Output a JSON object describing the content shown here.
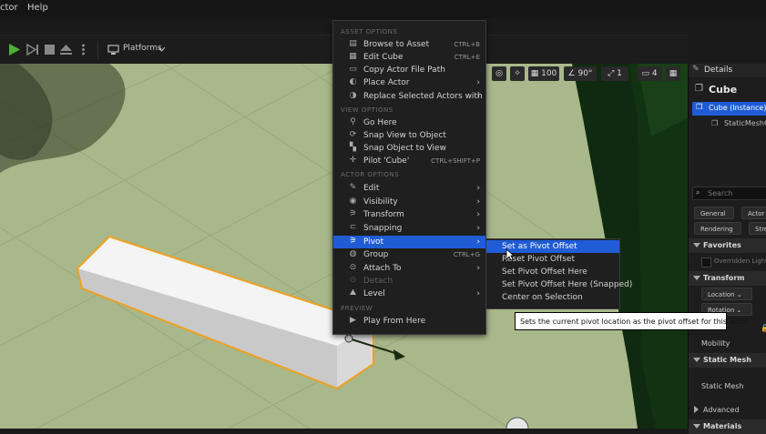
{
  "menubar": {
    "items": [
      "ctor",
      "Help"
    ]
  },
  "toolbar": {
    "platforms_label": "Platforms"
  },
  "viewport": {
    "tools": {
      "grid": "100",
      "angle": "90°",
      "scale": "1",
      "camera": "4"
    }
  },
  "context_menu": {
    "sections": {
      "asset": "ASSET OPTIONS",
      "view": "VIEW OPTIONS",
      "actor": "ACTOR OPTIONS",
      "preview": "PREVIEW"
    },
    "items": [
      {
        "label": "Browse to Asset",
        "shortcut": "CTRL+B",
        "icon": "folder-icon"
      },
      {
        "label": "Edit Cube",
        "shortcut": "CTRL+E",
        "icon": "edit-asset-icon"
      },
      {
        "label": "Copy Actor File Path",
        "shortcut": "",
        "icon": "copy-icon"
      },
      {
        "label": "Place Actor",
        "submenu": true,
        "icon": "place-actor-icon"
      },
      {
        "label": "Replace Selected Actors with",
        "submenu": true,
        "icon": "replace-icon"
      },
      {
        "label": "Go Here",
        "icon": "go-here-icon"
      },
      {
        "label": "Snap View to Object",
        "icon": "snap-view-icon"
      },
      {
        "label": "Snap Object to View",
        "icon": "snap-object-icon"
      },
      {
        "label": "Pilot 'Cube'",
        "shortcut": "CTRL+SHIFT+P",
        "icon": "pilot-icon"
      },
      {
        "label": "Edit",
        "submenu": true,
        "icon": "pencil-icon"
      },
      {
        "label": "Visibility",
        "submenu": true,
        "icon": "eye-icon"
      },
      {
        "label": "Transform",
        "submenu": true,
        "icon": "transform-icon"
      },
      {
        "label": "Snapping",
        "submenu": true,
        "icon": "magnet-icon"
      },
      {
        "label": "Pivot",
        "submenu": true,
        "icon": "pivot-icon"
      },
      {
        "label": "Group",
        "shortcut": "CTRL+G",
        "icon": "group-icon"
      },
      {
        "label": "Attach To",
        "submenu": true,
        "icon": "attach-icon"
      },
      {
        "label": "Detach",
        "disabled": true,
        "icon": "detach-icon"
      },
      {
        "label": "Level",
        "submenu": true,
        "icon": "level-icon"
      },
      {
        "label": "Play From Here",
        "icon": "play-icon"
      }
    ]
  },
  "pivot_submenu": {
    "items": [
      "Set as Pivot Offset",
      "Reset Pivot Offset",
      "Set Pivot Offset Here",
      "Set Pivot Offset Here (Snapped)",
      "Center on Selection"
    ]
  },
  "tooltip": "Sets the current pivot location as the pivot offset for this actor",
  "details": {
    "title": "Details",
    "actor_name": "Cube",
    "tree": [
      "Cube (Instance)",
      "StaticMeshC"
    ],
    "search_placeholder": "Search",
    "filters": [
      "General",
      "Actor",
      "Rendering",
      "Stre"
    ],
    "sections": {
      "favorites": "Favorites",
      "favorites_item": "Overridden Light",
      "transform": "Transform",
      "location": "Location",
      "rotation": "Rotation",
      "mobility": "Mobility",
      "static_mesh": "Static Mesh",
      "static_mesh_prop": "Static Mesh",
      "advanced": "Advanced",
      "materials": "Materials"
    }
  },
  "colors": {
    "selection": "#1f5cd6",
    "grass": "#a9b88a",
    "panel": "#1d1d1d",
    "cube_outline": "#f0a020"
  }
}
